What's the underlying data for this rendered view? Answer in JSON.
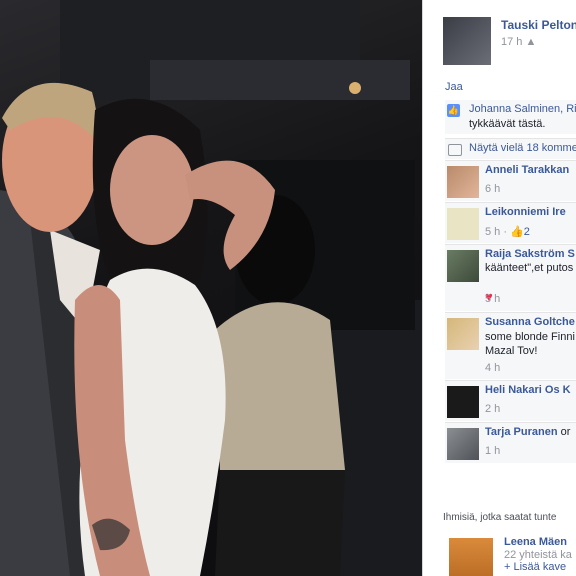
{
  "post": {
    "author": "Tauski Pelton",
    "time": "17 h",
    "share_link": "Jaa"
  },
  "likes": {
    "line1": "Johanna Salminen, Ri",
    "line2": "tykkäävät tästä."
  },
  "more_comments": "Näytä vielä 18 komme",
  "comments": [
    {
      "name": "Anneli Tarakkan",
      "body": "",
      "time": "6 h"
    },
    {
      "name": "Leikonniemi Ire",
      "body": "",
      "time": "5 h · ",
      "likes": "2"
    },
    {
      "name": "Raija Sakström S",
      "body": "käänteet\",et putos",
      "time": "5 h"
    },
    {
      "name": "Susanna Goltche",
      "body": "some blonde Finni",
      "body2": "Mazal Tov!",
      "time": "4 h"
    },
    {
      "name": "Heli Nakari Os K",
      "body": "",
      "time": "2 h"
    },
    {
      "name": "Tarja Puranen",
      "name_suffix": " or",
      "body": "",
      "time": "1 h"
    }
  ],
  "people_you_may_know": {
    "title": "Ihmisiä, jotka saatat tunte",
    "friend": {
      "name": "Leena Mäen",
      "mutual": "22 yhteistä ka",
      "add": "Lisää kave"
    }
  },
  "colors": {
    "link": "#3b5998",
    "heart": "#f0284a"
  },
  "icons": [
    "like-thumb-icon",
    "comments-icon",
    "heart-icon",
    "add-friend-icon"
  ]
}
